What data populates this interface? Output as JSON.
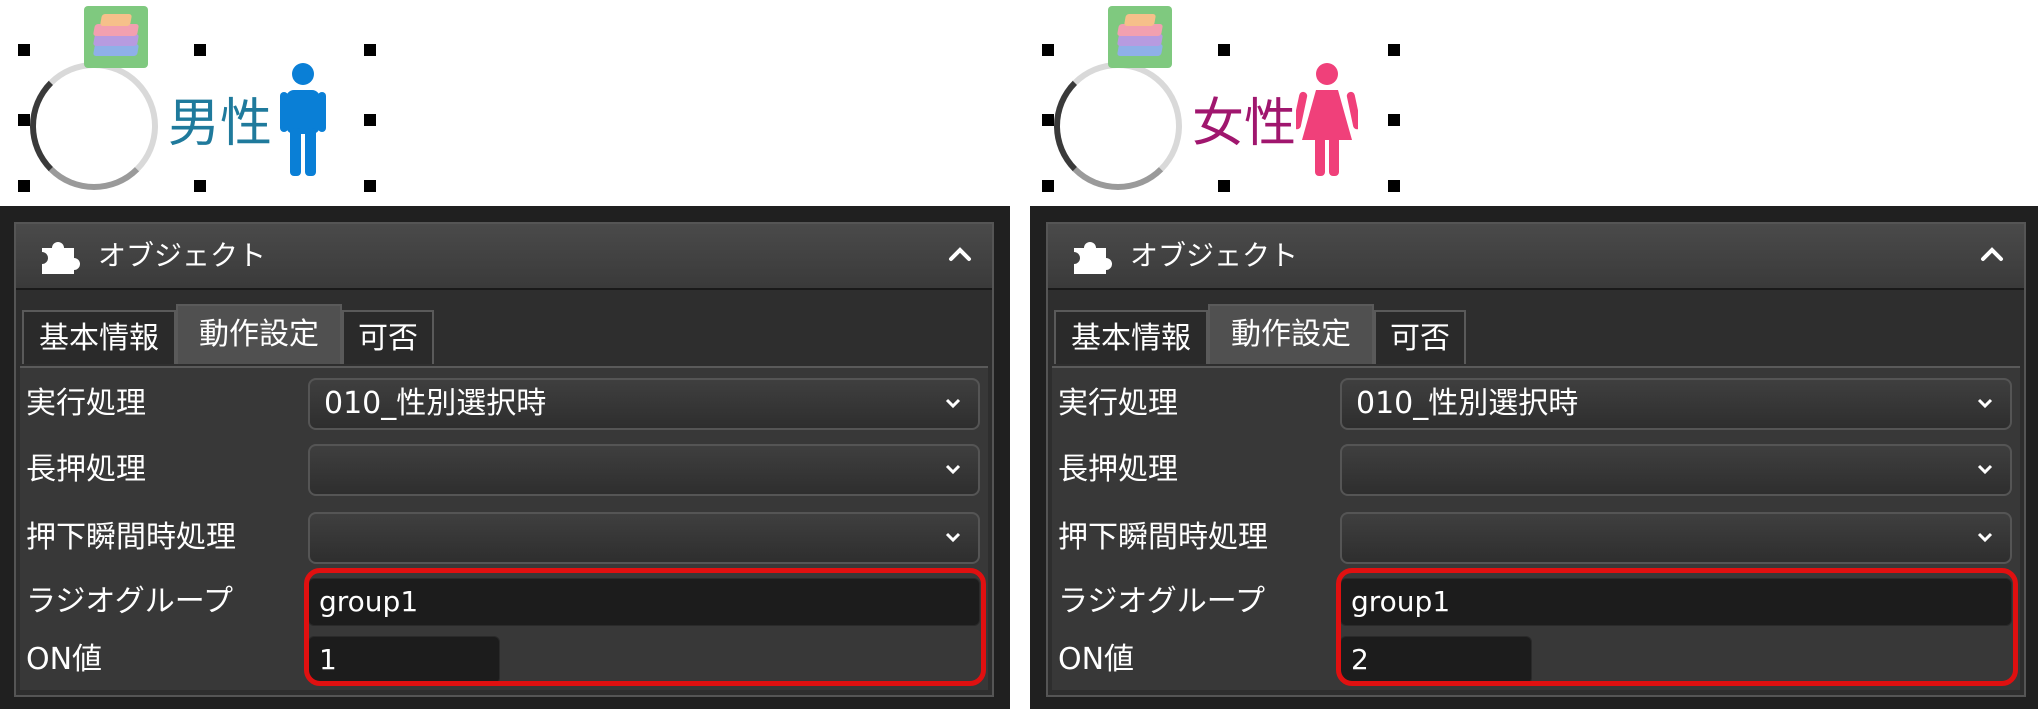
{
  "panels": [
    {
      "gender_label": "男性",
      "panel_title": "オブジェクト",
      "tabs": [
        "基本情報",
        "動作設定",
        "可否"
      ],
      "fields": {
        "exec_label": "実行処理",
        "exec_value": "010_性別選択時",
        "longpress_label": "長押処理",
        "longpress_value": "",
        "press_label": "押下瞬間時処理",
        "press_value": "",
        "radio_group_label": "ラジオグループ",
        "radio_group_value": "group1",
        "on_value_label": "ON値",
        "on_value": "1"
      }
    },
    {
      "gender_label": "女性",
      "panel_title": "オブジェクト",
      "tabs": [
        "基本情報",
        "動作設定",
        "可否"
      ],
      "fields": {
        "exec_label": "実行処理",
        "exec_value": "010_性別選択時",
        "longpress_label": "長押処理",
        "longpress_value": "",
        "press_label": "押下瞬間時処理",
        "press_value": "",
        "radio_group_label": "ラジオグループ",
        "radio_group_value": "group1",
        "on_value_label": "ON値",
        "on_value": "2"
      }
    }
  ],
  "colors": {
    "male": "#0a7fd6",
    "female": "#f0407a",
    "highlight": "#e01010"
  },
  "icons": [
    "layers-icon",
    "male-figure-icon",
    "female-figure-icon",
    "puzzle-icon",
    "chevron-up-icon",
    "chevron-down-icon"
  ]
}
